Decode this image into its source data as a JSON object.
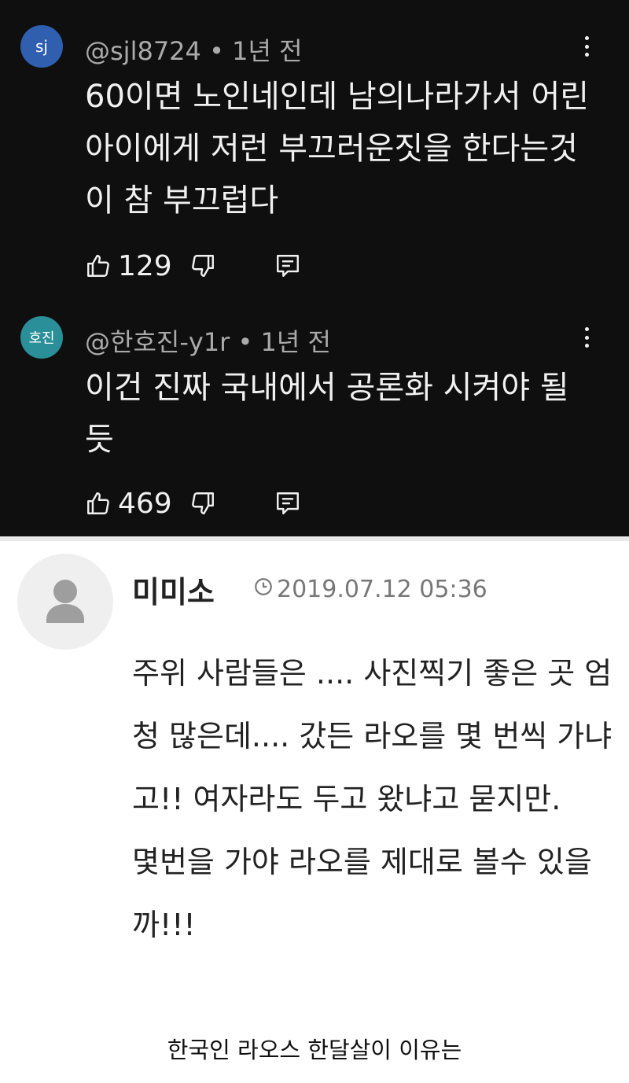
{
  "youtube_comments": [
    {
      "avatar_text": "sj",
      "avatar_color": "#2f5fae",
      "handle": "@sjl8724",
      "time": "1년 전",
      "text": "60이면 노인네인데 남의나라가서 어린아이에게 저런 부끄러운짓을 한다는것이 참 부끄럽다",
      "likes": "129"
    },
    {
      "avatar_text": "호진",
      "avatar_color": "#2a8f98",
      "handle": "@한호진-y1r",
      "time": "1년 전",
      "text": "이건 진짜 국내에서 공론화 시켜야 될듯",
      "likes": "469"
    }
  ],
  "cafe_comment": {
    "username": "미미소",
    "datetime": "2019.07.12 05:36",
    "text": "주위 사람들은 .... 사진찍기 좋은 곳 엄청 많은데.... 갔든 라오를 몇 번씩 가냐고!!  여자라도  두고 왔냐고 묻지만.\n몇번을  가야 라오를 제대로 볼수 있을까!!!"
  },
  "caption": "한국인 라오스 한달살이 이유는 "
}
